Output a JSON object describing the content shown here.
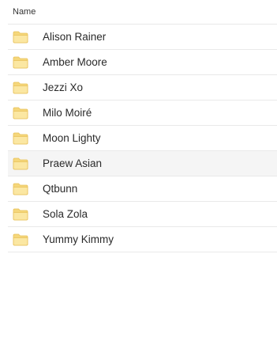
{
  "header": {
    "name_column": "Name"
  },
  "folders": [
    {
      "name": "Alison Rainer"
    },
    {
      "name": "Amber Moore"
    },
    {
      "name": "Jezzi Xo"
    },
    {
      "name": "Milo Moiré"
    },
    {
      "name": "Moon Lighty"
    },
    {
      "name": "Praew Asian"
    },
    {
      "name": "Qtbunn"
    },
    {
      "name": "Sola Zola"
    },
    {
      "name": "Yummy Kimmy"
    }
  ],
  "colors": {
    "folder_fill": "#fbe7a2",
    "folder_tab": "#f5d77b",
    "folder_stroke": "#e8c15a",
    "row_hover": "#f5f5f5",
    "divider": "#e9e9e9"
  },
  "icons": {
    "folder": "folder-icon"
  },
  "hovered_index": 5
}
